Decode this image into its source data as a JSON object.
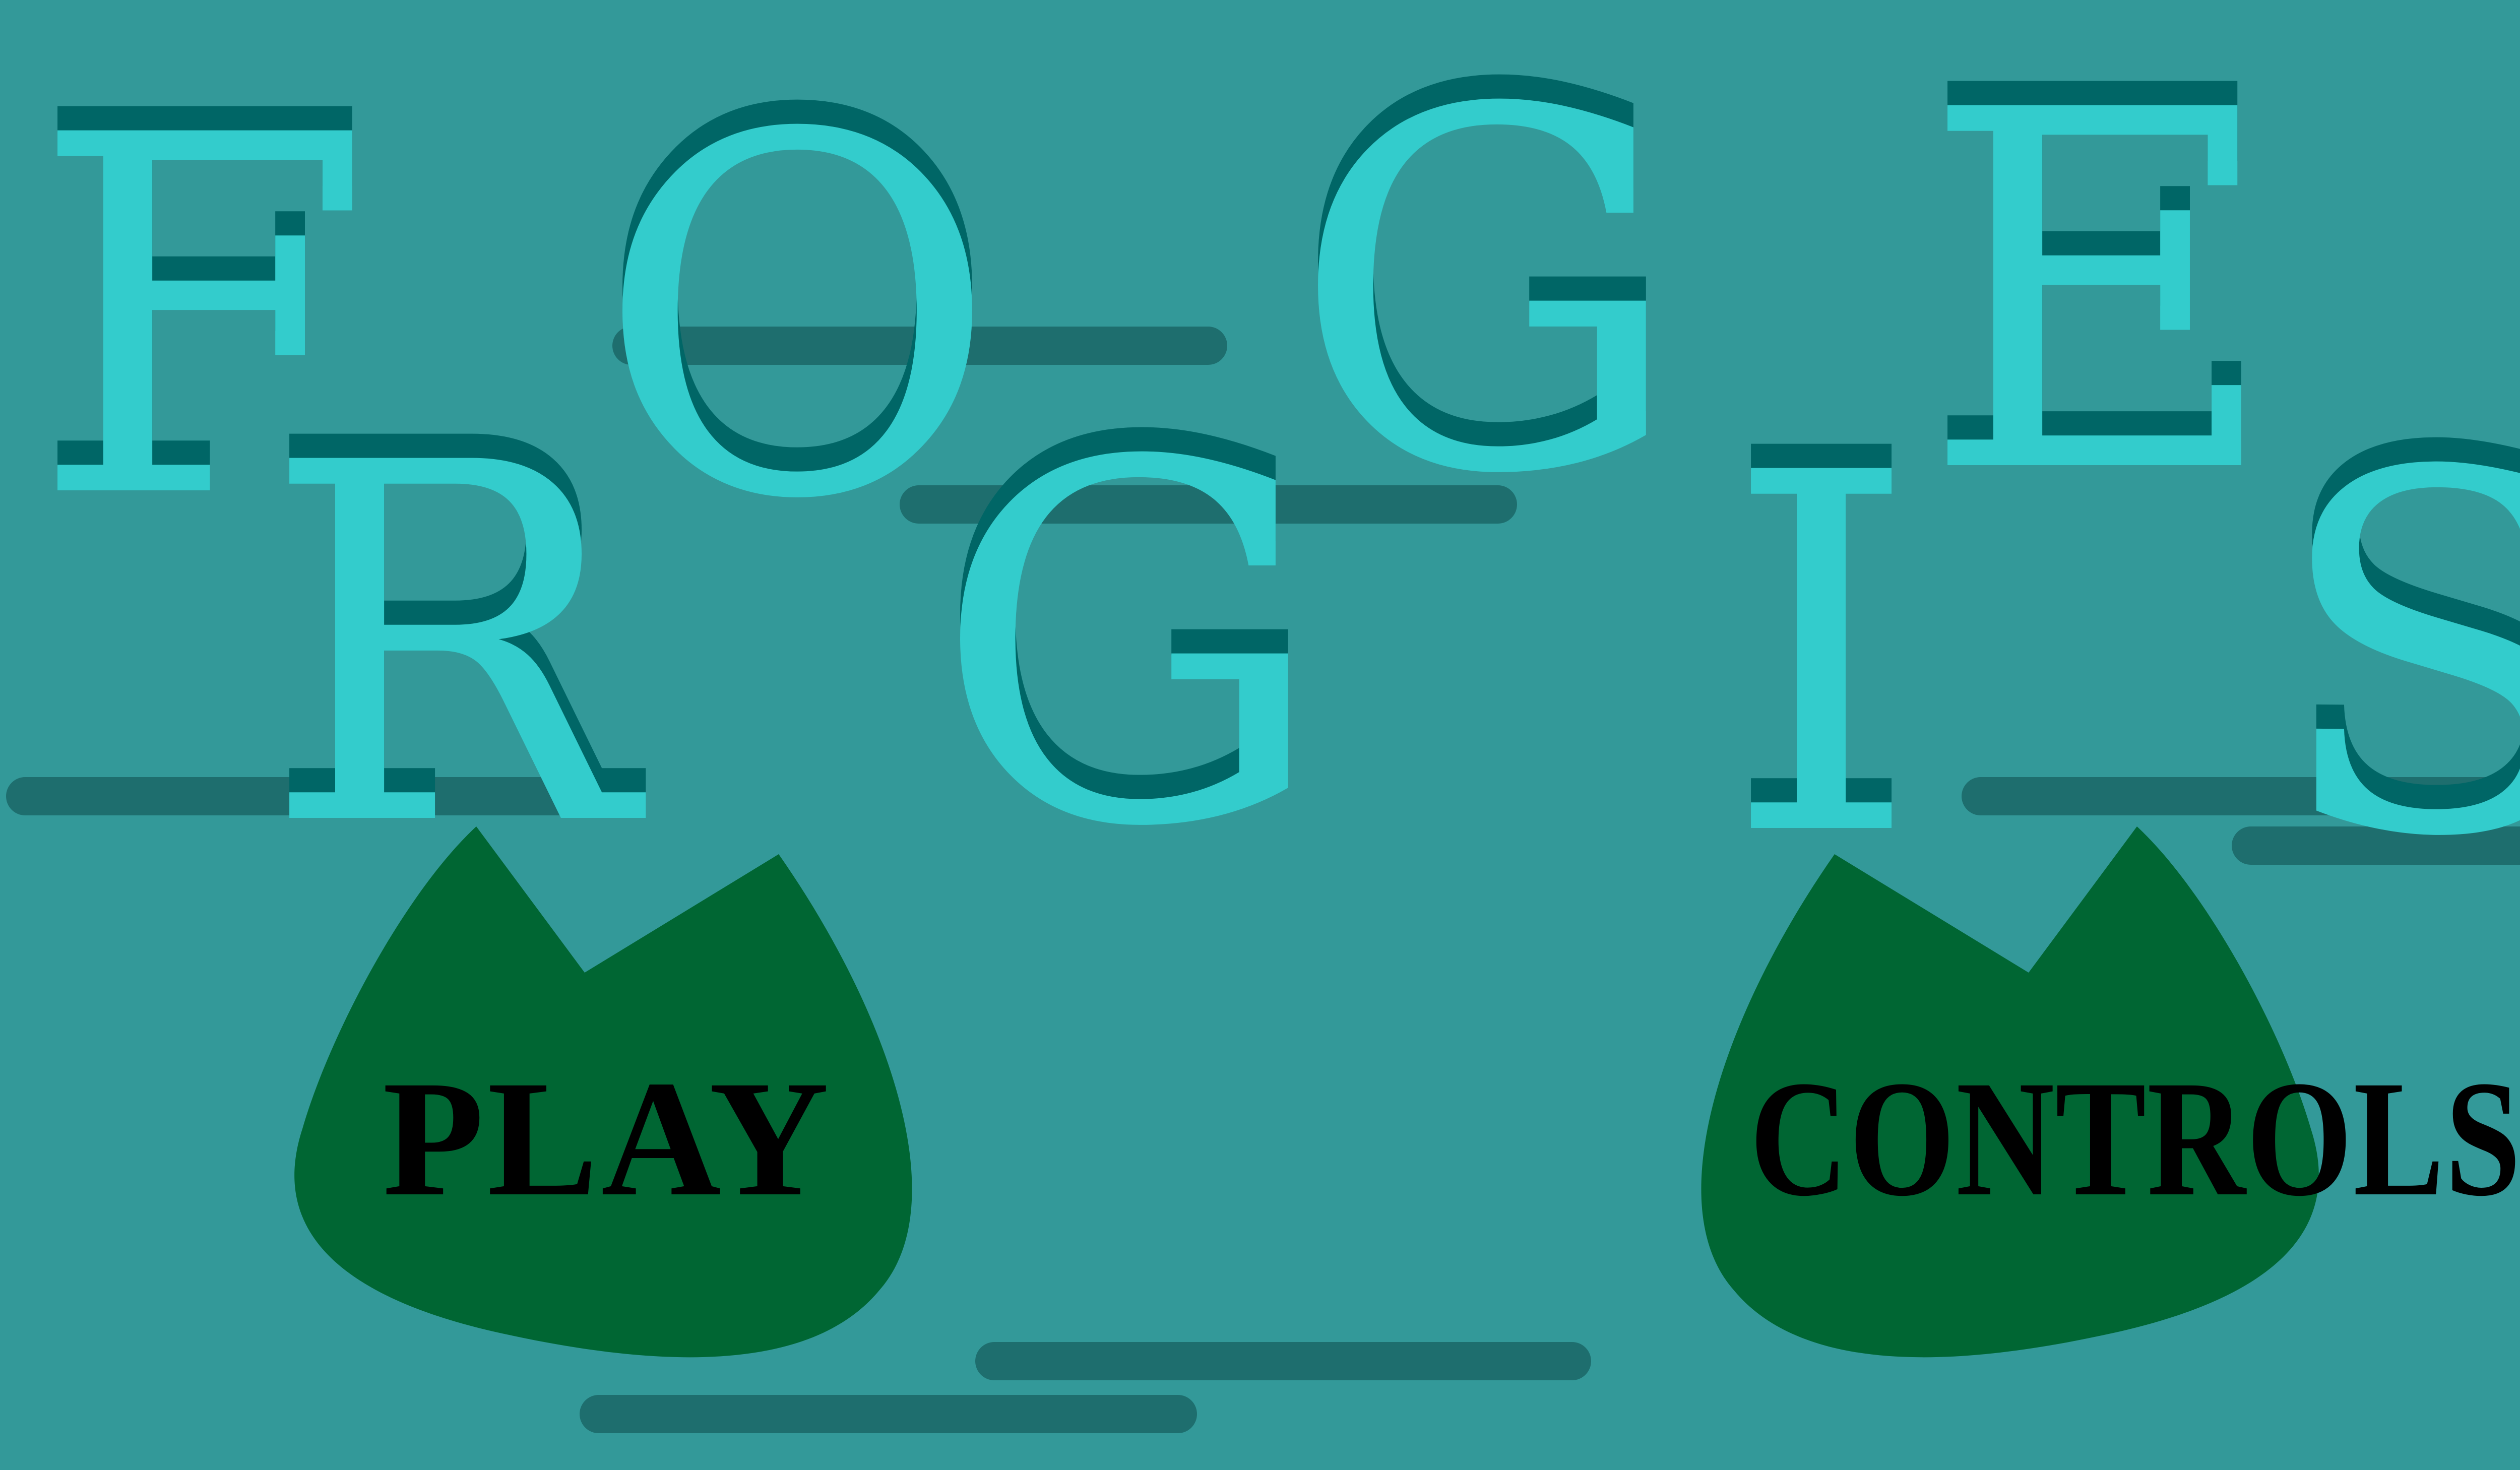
{
  "colors": {
    "background": "#339999",
    "title_face": "#33CCCC",
    "title_shadow": "#006666",
    "streak": "#1E6E6E",
    "leaf": "#006633",
    "button_text": "#000000"
  },
  "title": {
    "word_top": "FOGE",
    "word_bottom": "RGIS",
    "letters": [
      {
        "char": "F"
      },
      {
        "char": "O"
      },
      {
        "char": "G"
      },
      {
        "char": "E"
      },
      {
        "char": "R"
      },
      {
        "char": "G"
      },
      {
        "char": "I"
      },
      {
        "char": "S"
      }
    ]
  },
  "menu": {
    "play": {
      "label": "PLAY",
      "icon": "leaf-shape"
    },
    "controls": {
      "label": "CONTROLS",
      "icon": "leaf-shape"
    }
  }
}
